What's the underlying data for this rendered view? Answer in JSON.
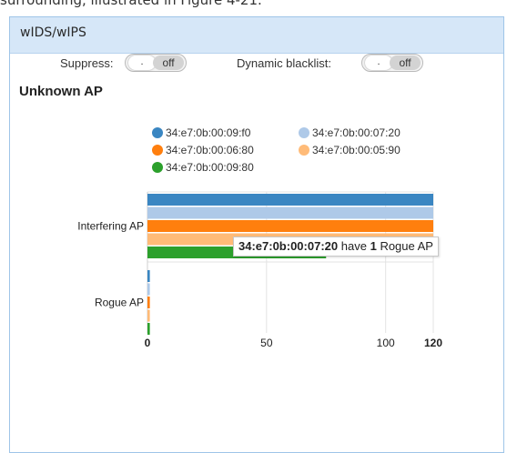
{
  "page_caption": "surrounding, illustrated in Figure 4-21.",
  "panel": {
    "title": "wIDS/wIPS"
  },
  "controls": {
    "suppress": {
      "label": "Suppress:",
      "knob": ".",
      "state": "off"
    },
    "dynamic_blacklist": {
      "label": "Dynamic blacklist:",
      "knob": ".",
      "state": "off"
    }
  },
  "section": {
    "title": "Unknown AP"
  },
  "tooltip": {
    "mac": "34:e7:0b:00:07:20",
    "text1": "have",
    "count": "1",
    "text2": "Rogue AP"
  },
  "chart_data": {
    "type": "bar",
    "orientation": "horizontal",
    "categories": [
      "Interfering AP",
      "Rogue AP"
    ],
    "series": [
      {
        "name": "34:e7:0b:00:09:f0",
        "color": "#3a86c2",
        "values": [
          120,
          1
        ]
      },
      {
        "name": "34:e7:0b:00:07:20",
        "color": "#aec9e8",
        "values": [
          120,
          1
        ]
      },
      {
        "name": "34:e7:0b:00:06:80",
        "color": "#ff7f0e",
        "values": [
          120,
          1
        ]
      },
      {
        "name": "34:e7:0b:00:05:90",
        "color": "#ffbb78",
        "values": [
          120,
          1
        ]
      },
      {
        "name": "34:e7:0b:00:09:80",
        "color": "#2ca02c",
        "values": [
          75,
          1
        ]
      }
    ],
    "xlim": [
      0,
      120
    ],
    "xticks": [
      "0",
      "50",
      "100",
      "120"
    ],
    "grid": true,
    "legend_position": "top"
  }
}
